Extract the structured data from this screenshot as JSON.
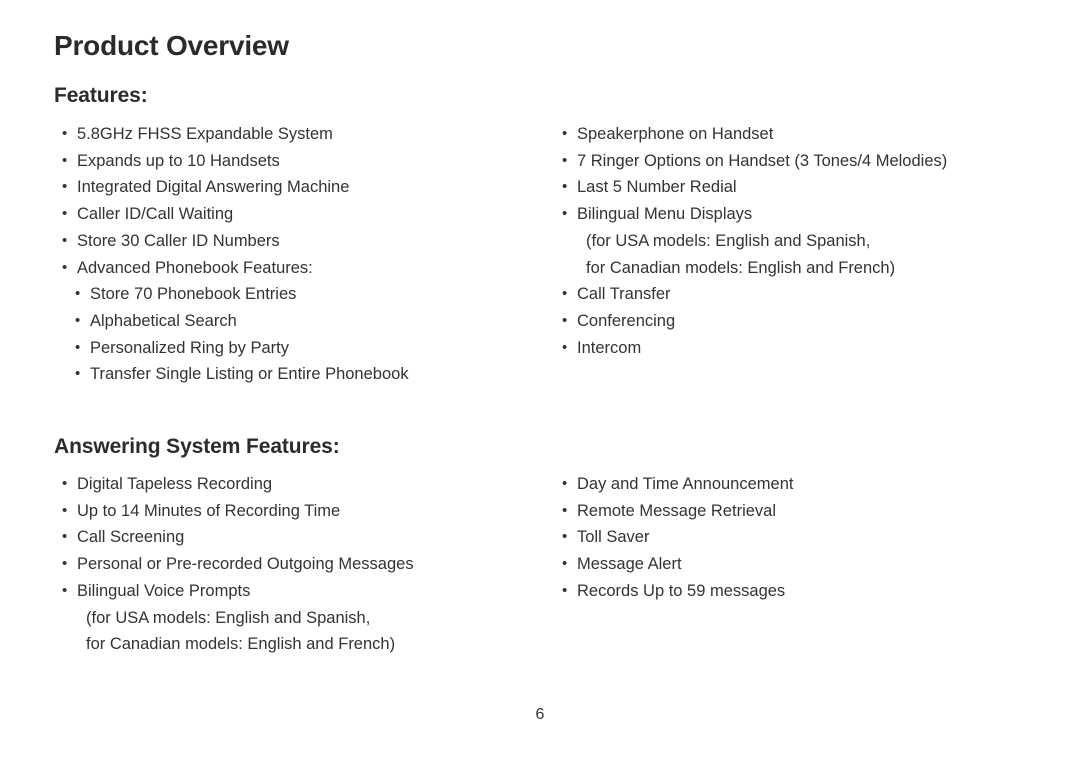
{
  "document": {
    "title": "Product Overview",
    "page_number": "6"
  },
  "sections": [
    {
      "heading": "Features:",
      "left_column": [
        {
          "level": 1,
          "text": "5.8GHz FHSS Expandable System"
        },
        {
          "level": 1,
          "text": "Expands up to 10 Handsets"
        },
        {
          "level": 1,
          "text": "Integrated Digital Answering Machine"
        },
        {
          "level": 1,
          "text": "Caller ID/Call Waiting"
        },
        {
          "level": 1,
          "text": "Store 30 Caller ID Numbers"
        },
        {
          "level": 1,
          "text": "Advanced Phonebook Features:"
        },
        {
          "level": 2,
          "text": "Store 70 Phonebook Entries"
        },
        {
          "level": 2,
          "text": "Alphabetical Search"
        },
        {
          "level": 2,
          "text": "Personalized Ring by Party"
        },
        {
          "level": 2,
          "text": "Transfer Single Listing or Entire Phonebook"
        }
      ],
      "right_column": [
        {
          "level": 1,
          "text": "Speakerphone on Handset"
        },
        {
          "level": 1,
          "text": "7 Ringer Options on Handset (3 Tones/4 Melodies)"
        },
        {
          "level": 1,
          "text": "Last 5 Number Redial"
        },
        {
          "level": 1,
          "text": "Bilingual Menu Displays",
          "continuation": [
            "(for USA models: English and Spanish,",
            "for Canadian models: English and French)"
          ]
        },
        {
          "level": 1,
          "text": "Call Transfer"
        },
        {
          "level": 1,
          "text": "Conferencing"
        },
        {
          "level": 1,
          "text": "Intercom"
        }
      ]
    },
    {
      "heading": "Answering System Features:",
      "left_column": [
        {
          "level": 1,
          "text": "Digital Tapeless Recording"
        },
        {
          "level": 1,
          "text": "Up to 14 Minutes of Recording Time"
        },
        {
          "level": 1,
          "text": "Call Screening"
        },
        {
          "level": 1,
          "text": "Personal or Pre-recorded Outgoing Messages"
        },
        {
          "level": 1,
          "text": "Bilingual Voice Prompts",
          "continuation": [
            "(for USA models: English and Spanish,",
            "for Canadian models: English and French)"
          ]
        }
      ],
      "right_column": [
        {
          "level": 1,
          "text": "Day and Time Announcement"
        },
        {
          "level": 1,
          "text": "Remote Message Retrieval"
        },
        {
          "level": 1,
          "text": "Toll Saver"
        },
        {
          "level": 1,
          "text": "Message Alert"
        },
        {
          "level": 1,
          "text": "Records Up to 59 messages"
        }
      ]
    }
  ]
}
